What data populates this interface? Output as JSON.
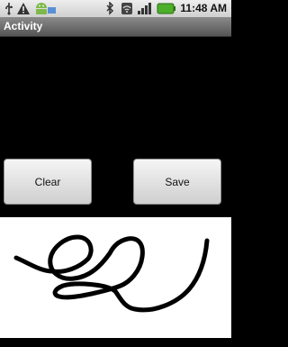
{
  "status": {
    "time": "11:48 AM",
    "icons": [
      "usb-icon",
      "warning-icon",
      "android-icon",
      "bluetooth-icon",
      "signal-icon",
      "wifi-icon",
      "battery-icon"
    ]
  },
  "app": {
    "title": "Activity"
  },
  "buttons": {
    "clear_label": "Clear",
    "save_label": "Save"
  },
  "colors": {
    "status_bg": "#e6e6e6",
    "title_bg": "#6e6e6e",
    "content_bg": "#000000",
    "canvas_bg": "#ffffff",
    "stroke": "#000000"
  }
}
